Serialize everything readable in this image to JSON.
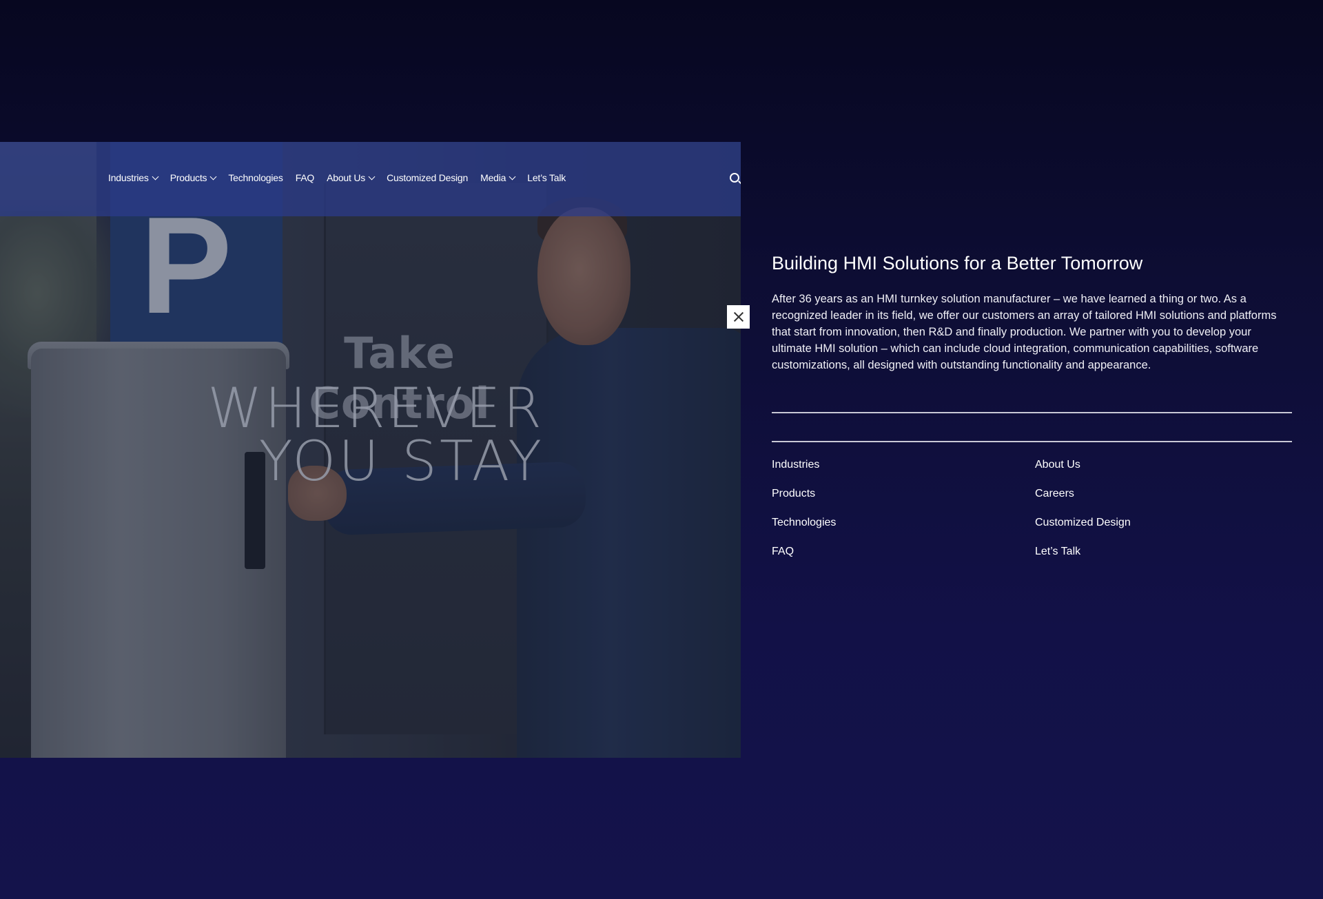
{
  "nav": {
    "items": [
      {
        "label": "Industries",
        "has_dropdown": true
      },
      {
        "label": "Products",
        "has_dropdown": true
      },
      {
        "label": "Technologies",
        "has_dropdown": false
      },
      {
        "label": "FAQ",
        "has_dropdown": false
      },
      {
        "label": "About Us",
        "has_dropdown": true
      },
      {
        "label": "Customized Design",
        "has_dropdown": false
      },
      {
        "label": "Media",
        "has_dropdown": true
      },
      {
        "label": "Let’s Talk",
        "has_dropdown": false
      }
    ],
    "search_icon": "search-icon"
  },
  "hero": {
    "kicker": "Take Control",
    "line1": "WHEREVER",
    "line2": "YOU STAY"
  },
  "panel": {
    "title": "Building HMI Solutions for a Better Tomorrow",
    "description": "After 36 years as an HMI turnkey solution manufacturer – we have learned a thing or two. As a recognized leader in its field, we offer our customers an array of tailored HMI solutions and platforms that start from innovation, then R&D and finally production. We partner with you to develop your ultimate HMI solution – which can include cloud integration, communication capabilities, software customizations, all designed with outstanding functionality and appearance.",
    "links_left": [
      "Industries",
      "Products",
      "Technologies",
      "FAQ"
    ],
    "links_right": [
      "About Us",
      "Careers",
      "Customized Design",
      "Let’s Talk"
    ]
  },
  "close_icon": "close-icon",
  "colors": {
    "background": "#0d0d33",
    "nav_bar": "#2b3c8c",
    "text": "#ffffff"
  }
}
